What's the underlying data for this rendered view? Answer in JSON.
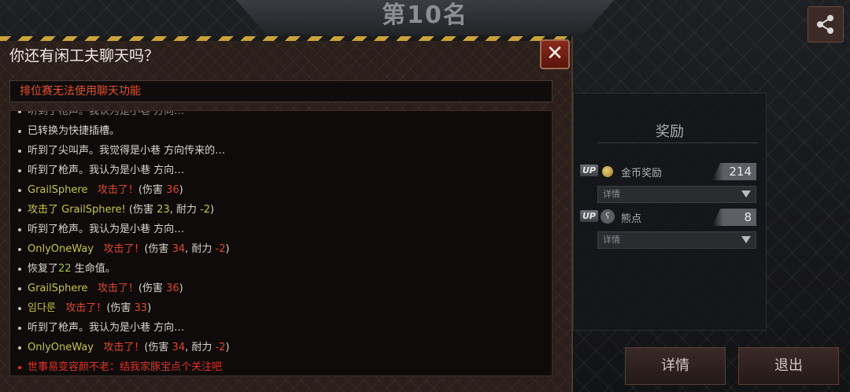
{
  "header": {
    "rank_title": "第10名"
  },
  "dialog": {
    "title": "你还有闲工夫聊天吗？",
    "close_label": "✕",
    "notice": "排位赛无法使用聊天功能"
  },
  "chat": {
    "partial_top": "听到了枪声。我认为是小巷 方向…",
    "m1": "已转换为快捷插槽。",
    "m2": "听到了尖叫声。我觉得是小巷 方向传来的…",
    "m3": "听到了枪声。我认为是小巷 方向…",
    "m4_name": "GrailSphere",
    "m4_act": "攻击了！",
    "m4_pre": "(伤害 ",
    "m4_dmg": "36",
    "m4_post": ")",
    "m5_a": "攻击了 ",
    "m5_name": "GrailSphere!",
    "m5_b": " (伤害 ",
    "m5_dmg": "23",
    "m5_c": ", 耐力 ",
    "m5_dur": "-2",
    "m5_d": ")",
    "m6": "听到了枪声。我认为是小巷 方向…",
    "m7_name": "OnlyOneWay",
    "m7_act": "攻击了！",
    "m7_pre": "(伤害 ",
    "m7_dmg": "34",
    "m7_mid": ", 耐力 ",
    "m7_dur": "-2",
    "m7_post": ")",
    "m8_a": "恢复了",
    "m8_num": "22",
    "m8_b": " 生命值。",
    "m9_name": "GrailSphere",
    "m9_act": "攻击了！",
    "m9_pre": "(伤害 ",
    "m9_dmg": "36",
    "m9_post": ")",
    "m10_name": "임다룬",
    "m10_act": "攻击了！",
    "m10_pre": "(伤害 ",
    "m10_dmg": "33",
    "m10_post": ")",
    "m11": "听到了枪声。我认为是小巷 方向…",
    "m12_name": "OnlyOneWay",
    "m12_act": "攻击了！",
    "m12_pre": "(伤害 ",
    "m12_dmg": "34",
    "m12_mid": ", 耐力 ",
    "m12_dur": "-2",
    "m12_post": ")",
    "m13": "世事易变容颜不老：结我家豚宝点个关注吧"
  },
  "reward": {
    "title": "奖励",
    "up_badge": "UP",
    "gold_label": "金币奖励",
    "gold_value": "214",
    "gold_detail": "详情",
    "bear_label": "熊点",
    "bear_value": "8",
    "bear_detail": "详情"
  },
  "buttons": {
    "detail": "详情",
    "exit": "退出"
  }
}
